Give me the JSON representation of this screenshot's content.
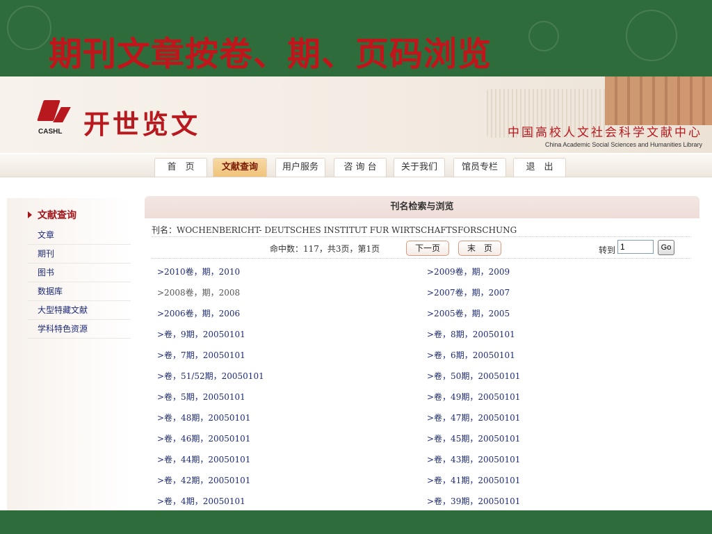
{
  "slide": {
    "title": "期刊文章按卷、期、页码浏览"
  },
  "header": {
    "logo_sub": "CASHL",
    "logo_text": "开世览文",
    "org_cn": "中国高校人文社会科学文献中心",
    "org_en": "China Academic Social Sciences and Humanities Library"
  },
  "nav": {
    "items": [
      "首　页",
      "文献查询",
      "用户服务",
      "咨 询 台",
      "关于我们",
      "馆员专栏",
      "退　出"
    ],
    "active_index": 1
  },
  "sidebar": {
    "heading": "文献查询",
    "items": [
      "文章",
      "期刊",
      "图书",
      "数据库",
      "大型特藏文献",
      "学科特色资源"
    ]
  },
  "main": {
    "heading": "刊名检索与浏览",
    "journal": "刊名：WOCHENBERICHT- DEUTSCHES INSTITUT FUR WIRTSCHAFTSFORSCHUNG",
    "hits": "命中数：117，共3页，第1页",
    "next_label": "下一页",
    "last_label": "末　页",
    "goto_label": "转到",
    "goto_value": "1",
    "go_label": "Go",
    "rows": [
      [
        ">2010卷，期，2010",
        ">2009卷，期，2009"
      ],
      [
        ">2008卷，期，2008",
        ">2007卷，期，2007"
      ],
      [
        ">2006卷，期，2006",
        ">2005卷，期，2005"
      ],
      [
        ">卷，9期，20050101",
        ">卷，8期，20050101"
      ],
      [
        ">卷，7期，20050101",
        ">卷，6期，20050101"
      ],
      [
        ">卷，51/52期，20050101",
        ">卷，50期，20050101"
      ],
      [
        ">卷，5期，20050101",
        ">卷，49期，20050101"
      ],
      [
        ">卷，48期，20050101",
        ">卷，47期，20050101"
      ],
      [
        ">卷，46期，20050101",
        ">卷，45期，20050101"
      ],
      [
        ">卷，44期，20050101",
        ">卷，43期，20050101"
      ],
      [
        ">卷，42期，20050101",
        ">卷，41期，20050101"
      ],
      [
        ">卷，4期，20050101",
        ">卷，39期，20050101"
      ]
    ]
  },
  "colors": {
    "slide_bg": "#2f6c3b",
    "title_red": "#c0151b",
    "link_blue": "#1d2b78"
  }
}
